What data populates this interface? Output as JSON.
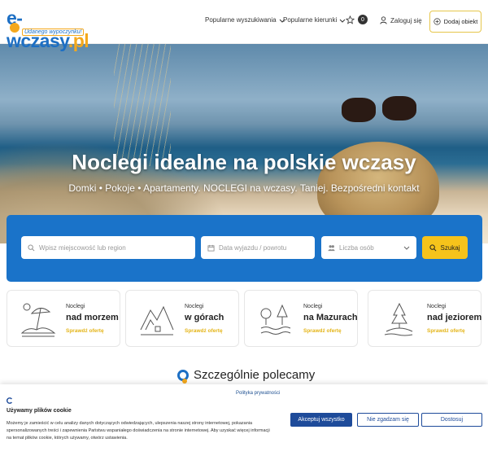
{
  "header": {
    "logo": {
      "prefix": "e",
      "domain": "-wczasy",
      "tld": ".pl",
      "tagline": "Udanego wypoczynku!"
    },
    "nav": [
      {
        "label": "Popularne wyszukiwania",
        "icon": "chevron-down-icon"
      },
      {
        "label": "Popularne kierunki",
        "icon": "chevron-down-icon"
      }
    ],
    "favorites": {
      "icon": "star-icon",
      "count": "0"
    },
    "login_label": "Zaloguj się",
    "add_property_label": "Dodaj obiekt"
  },
  "hero": {
    "title": "Noclegi idealne na polskie wczasy",
    "subtitle": "Domki • Pokoje • Apartamenty. NOCLEGI na wczasy. Taniej. Bezpośredni kontakt"
  },
  "search": {
    "location_placeholder": "Wpisz miejscowość lub region",
    "dates_placeholder": "Data wyjazdu / powrotu",
    "guests_placeholder": "Liczba osób",
    "button_label": "Szukaj"
  },
  "categories": [
    {
      "small": "Noclegi",
      "big": "nad morzem",
      "link": "Sprawdź ofertę",
      "icon": "beach-umbrella-icon"
    },
    {
      "small": "Noclegi",
      "big": "w górach",
      "link": "Sprawdź ofertę",
      "icon": "mountains-icon"
    },
    {
      "small": "Noclegi",
      "big": "na Mazurach",
      "link": "Sprawdź ofertę",
      "icon": "lake-trees-icon"
    },
    {
      "small": "Noclegi",
      "big": "nad jeziorem",
      "link": "Sprawdź ofertę",
      "icon": "lake-island-icon"
    }
  ],
  "section_title": "Szczególnie polecamy",
  "cookie": {
    "policy_link": "Polityka prywatności",
    "title": "Używamy plików cookie",
    "text": "Możemy je zamieścić w celu analizy danych dotyczących odwiedzających, ulepszenia naszej strony internetowej, pokazania spersonalizowanych treści i zapewnienia Państwu wspaniałego doświadczenia na stronie internetowej. Aby uzyskać więcej informacji na temat plików cookie, których używamy, otwórz ustawienia.",
    "accept_label": "Akceptuj wszystko",
    "deny_label": "Nie zgadzam się",
    "customize_label": "Dostosuj"
  },
  "colors": {
    "brand_blue": "#1d6fc4",
    "brand_orange": "#f4a81d",
    "search_bg": "#1a73c9",
    "search_button": "#f6c31b",
    "cookie_accept": "#1e4b9a"
  }
}
